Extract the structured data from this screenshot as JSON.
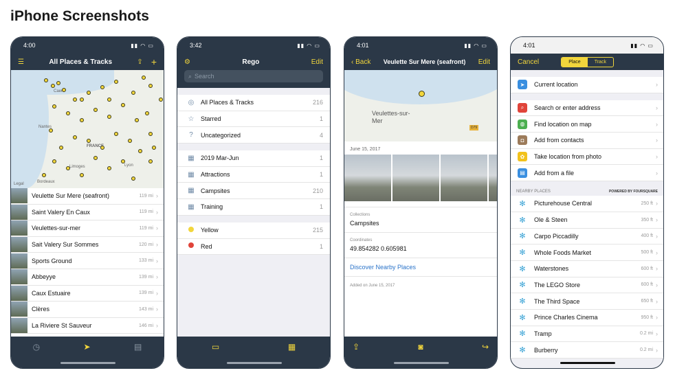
{
  "page_title": "iPhone Screenshots",
  "colors": {
    "nav_bg": "#2b3847",
    "accent": "#f2d63c",
    "link": "#2a73c9"
  },
  "phone1": {
    "time": "4:00",
    "title": "All Places & Tracks",
    "map_labels": [
      "Caen",
      "FRANCE",
      "Lyon",
      "Limoges",
      "Bordeaux",
      "Nantes",
      "Legal"
    ],
    "rows": [
      {
        "label": "Veulette Sur Mere (seafront)",
        "dist": "119 mi"
      },
      {
        "label": "Saint Valery En Caux",
        "dist": "119 mi"
      },
      {
        "label": "Veulettes-sur-mer",
        "dist": "119 mi"
      },
      {
        "label": "Sait Valery Sur Sommes",
        "dist": "120 mi"
      },
      {
        "label": "Sports Ground",
        "dist": "133 mi"
      },
      {
        "label": "Abbeyye",
        "dist": "139 mi"
      },
      {
        "label": "Caux Estuaire",
        "dist": "139 mi"
      },
      {
        "label": "Clères",
        "dist": "143 mi"
      },
      {
        "label": "La Riviere St Sauveur",
        "dist": "146 mi"
      }
    ]
  },
  "phone2": {
    "time": "3:42",
    "title": "Rego",
    "edit": "Edit",
    "search_placeholder": "Search",
    "group1": [
      {
        "label": "All Places & Tracks",
        "count": "216"
      },
      {
        "label": "Starred",
        "count": "1"
      },
      {
        "label": "Uncategorized",
        "count": "4"
      }
    ],
    "group2": [
      {
        "label": "2019 Mar-Jun",
        "count": "1"
      },
      {
        "label": "Attractions",
        "count": "1"
      },
      {
        "label": "Campsites",
        "count": "210"
      },
      {
        "label": "Training",
        "count": "1"
      }
    ],
    "group3": [
      {
        "label": "Yellow",
        "count": "215",
        "color": "#f2d63c"
      },
      {
        "label": "Red",
        "count": "1",
        "color": "#e0443a"
      }
    ]
  },
  "phone3": {
    "time": "4:01",
    "back": "Back",
    "title": "Veulette Sur Mere (seafront)",
    "edit": "Edit",
    "map_label": "Veulettes-sur-Mer",
    "map_badge": "D79",
    "date": "June 15, 2017",
    "collections_key": "Collections",
    "collections_value": "Campsites",
    "coordinates_key": "Coordinates",
    "coordinates_value": "49.854282 0.605981",
    "discover": "Discover Nearby Places",
    "added": "Added on June 15, 2017"
  },
  "phone4": {
    "time": "4:01",
    "cancel": "Cancel",
    "seg_place": "Place",
    "seg_track": "Track",
    "current_location": "Current location",
    "actions": [
      {
        "label": "Search or enter address",
        "color": "#e0443a",
        "icon": "search-icon"
      },
      {
        "label": "Find location on map",
        "color": "#4caf50",
        "icon": "globe-icon"
      },
      {
        "label": "Add from contacts",
        "color": "#9c7b5a",
        "icon": "contacts-icon"
      },
      {
        "label": "Take location from photo",
        "color": "#f2c21c",
        "icon": "photo-icon"
      },
      {
        "label": "Add from a file",
        "color": "#3a8fe0",
        "icon": "file-icon"
      }
    ],
    "nearby_header": "NEARBY PLACES",
    "powered_by": "POWERED BY FOURSQUARE",
    "nearby": [
      {
        "label": "Picturehouse Central",
        "dist": "250 ft"
      },
      {
        "label": "Ole & Steen",
        "dist": "350 ft"
      },
      {
        "label": "Carpo Piccadilly",
        "dist": "400 ft"
      },
      {
        "label": "Whole Foods Market",
        "dist": "500 ft"
      },
      {
        "label": "Waterstones",
        "dist": "600 ft"
      },
      {
        "label": "The LEGO Store",
        "dist": "600 ft"
      },
      {
        "label": "The Third Space",
        "dist": "650 ft"
      },
      {
        "label": "Prince Charles Cinema",
        "dist": "950 ft"
      },
      {
        "label": "Tramp",
        "dist": "0.2 mi"
      },
      {
        "label": "Burberry",
        "dist": "0.2 mi"
      }
    ]
  }
}
